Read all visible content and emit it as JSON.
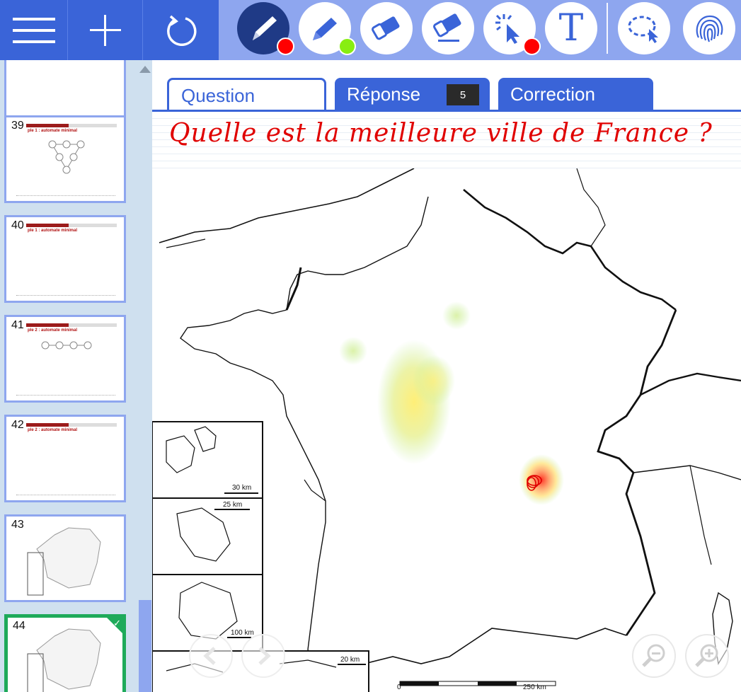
{
  "toolbar": {
    "menu_icon": "hamburger-menu-icon",
    "add_icon": "plus-icon",
    "refresh_icon": "refresh-icon",
    "tools": [
      {
        "name": "pen",
        "icon": "pen-icon",
        "dot_color": "#ff0000",
        "active": true
      },
      {
        "name": "highlighter",
        "icon": "highlighter-icon",
        "dot_color": "#88ee11"
      },
      {
        "name": "eraser",
        "icon": "eraser-icon"
      },
      {
        "name": "stroke-eraser",
        "icon": "stroke-eraser-icon"
      },
      {
        "name": "laser-pointer",
        "icon": "laser-pointer-icon",
        "dot_color": "#ff0000"
      },
      {
        "name": "text",
        "icon": "text-tool-icon",
        "label": "T"
      },
      {
        "name": "lasso-select",
        "icon": "lasso-select-icon"
      },
      {
        "name": "fingerprint",
        "icon": "fingerprint-icon"
      }
    ],
    "colors": {
      "dark_blue": "#3a64d8",
      "light_blue": "#8ea6ef",
      "active_tool": "#1f3a86"
    }
  },
  "sidebar": {
    "slides": [
      {
        "number": "",
        "title": ""
      },
      {
        "number": "39",
        "title": "ple 1 : automate minimal"
      },
      {
        "number": "40",
        "title": "ple 1 : automate minimal"
      },
      {
        "number": "41",
        "title": "ple 2 : automate minimal"
      },
      {
        "number": "42",
        "title": "ple 2 : automate minimal"
      },
      {
        "number": "43",
        "title": ""
      },
      {
        "number": "44",
        "title": "",
        "selected": true
      }
    ]
  },
  "tabs": {
    "question": "Question",
    "reponse": "Réponse",
    "reponse_count": "5",
    "correction": "Correction"
  },
  "question": {
    "handwritten": "Quelle est la meilleure ville de France ?",
    "ink_color": "#e00000"
  },
  "map": {
    "inset_scales": [
      "30 km",
      "25 km",
      "100 km",
      "20 km"
    ],
    "main_scale_start": "0",
    "main_scale_end": "250 km"
  },
  "nav": {
    "prev_icon": "chevron-left-icon",
    "next_icon": "chevron-right-icon",
    "zoom_out_icon": "zoom-out-icon",
    "zoom_in_icon": "zoom-in-icon"
  }
}
